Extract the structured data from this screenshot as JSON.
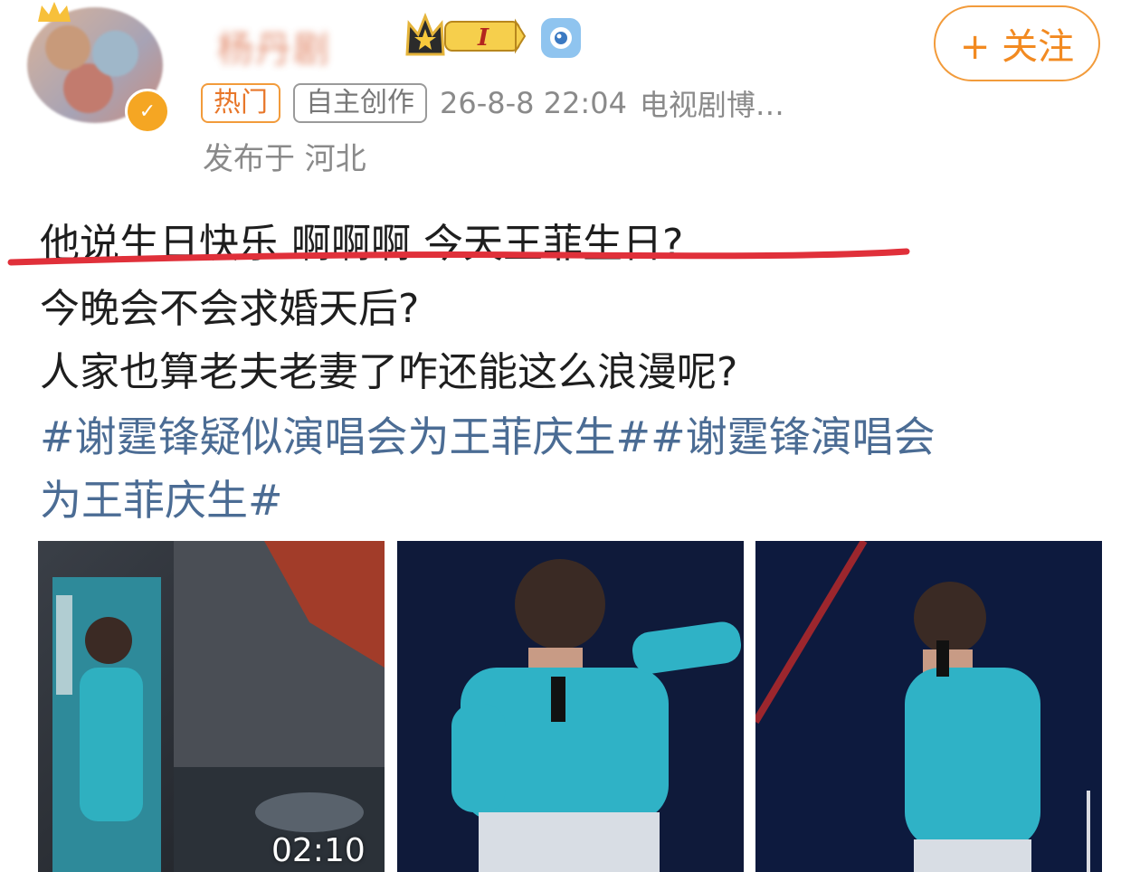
{
  "header": {
    "username": "杨丹剧",
    "vip_level": "I",
    "follow_label": "+ 关注",
    "tags": {
      "hot": "热门",
      "original": "自主创作"
    },
    "timestamp": "26-8-8 22:04",
    "source": "电视剧博…",
    "location": "发布于 河北"
  },
  "post": {
    "lines": [
      "他说生日快乐 啊啊啊 今天王菲生日?",
      "今晚会不会求婚天后?",
      "人家也算老夫老妻了咋还能这么浪漫呢?"
    ],
    "hashtag_line1": "#谢霆锋疑似演唱会为王菲庆生##谢霆锋演唱会",
    "hashtag_line2": "为王菲庆生#"
  },
  "media": {
    "video_duration": "02:10",
    "photo_count": 3
  },
  "colors": {
    "accent_orange": "#f28a21",
    "hashtag_blue": "#4b6c94",
    "underline_red": "#e0303a"
  }
}
